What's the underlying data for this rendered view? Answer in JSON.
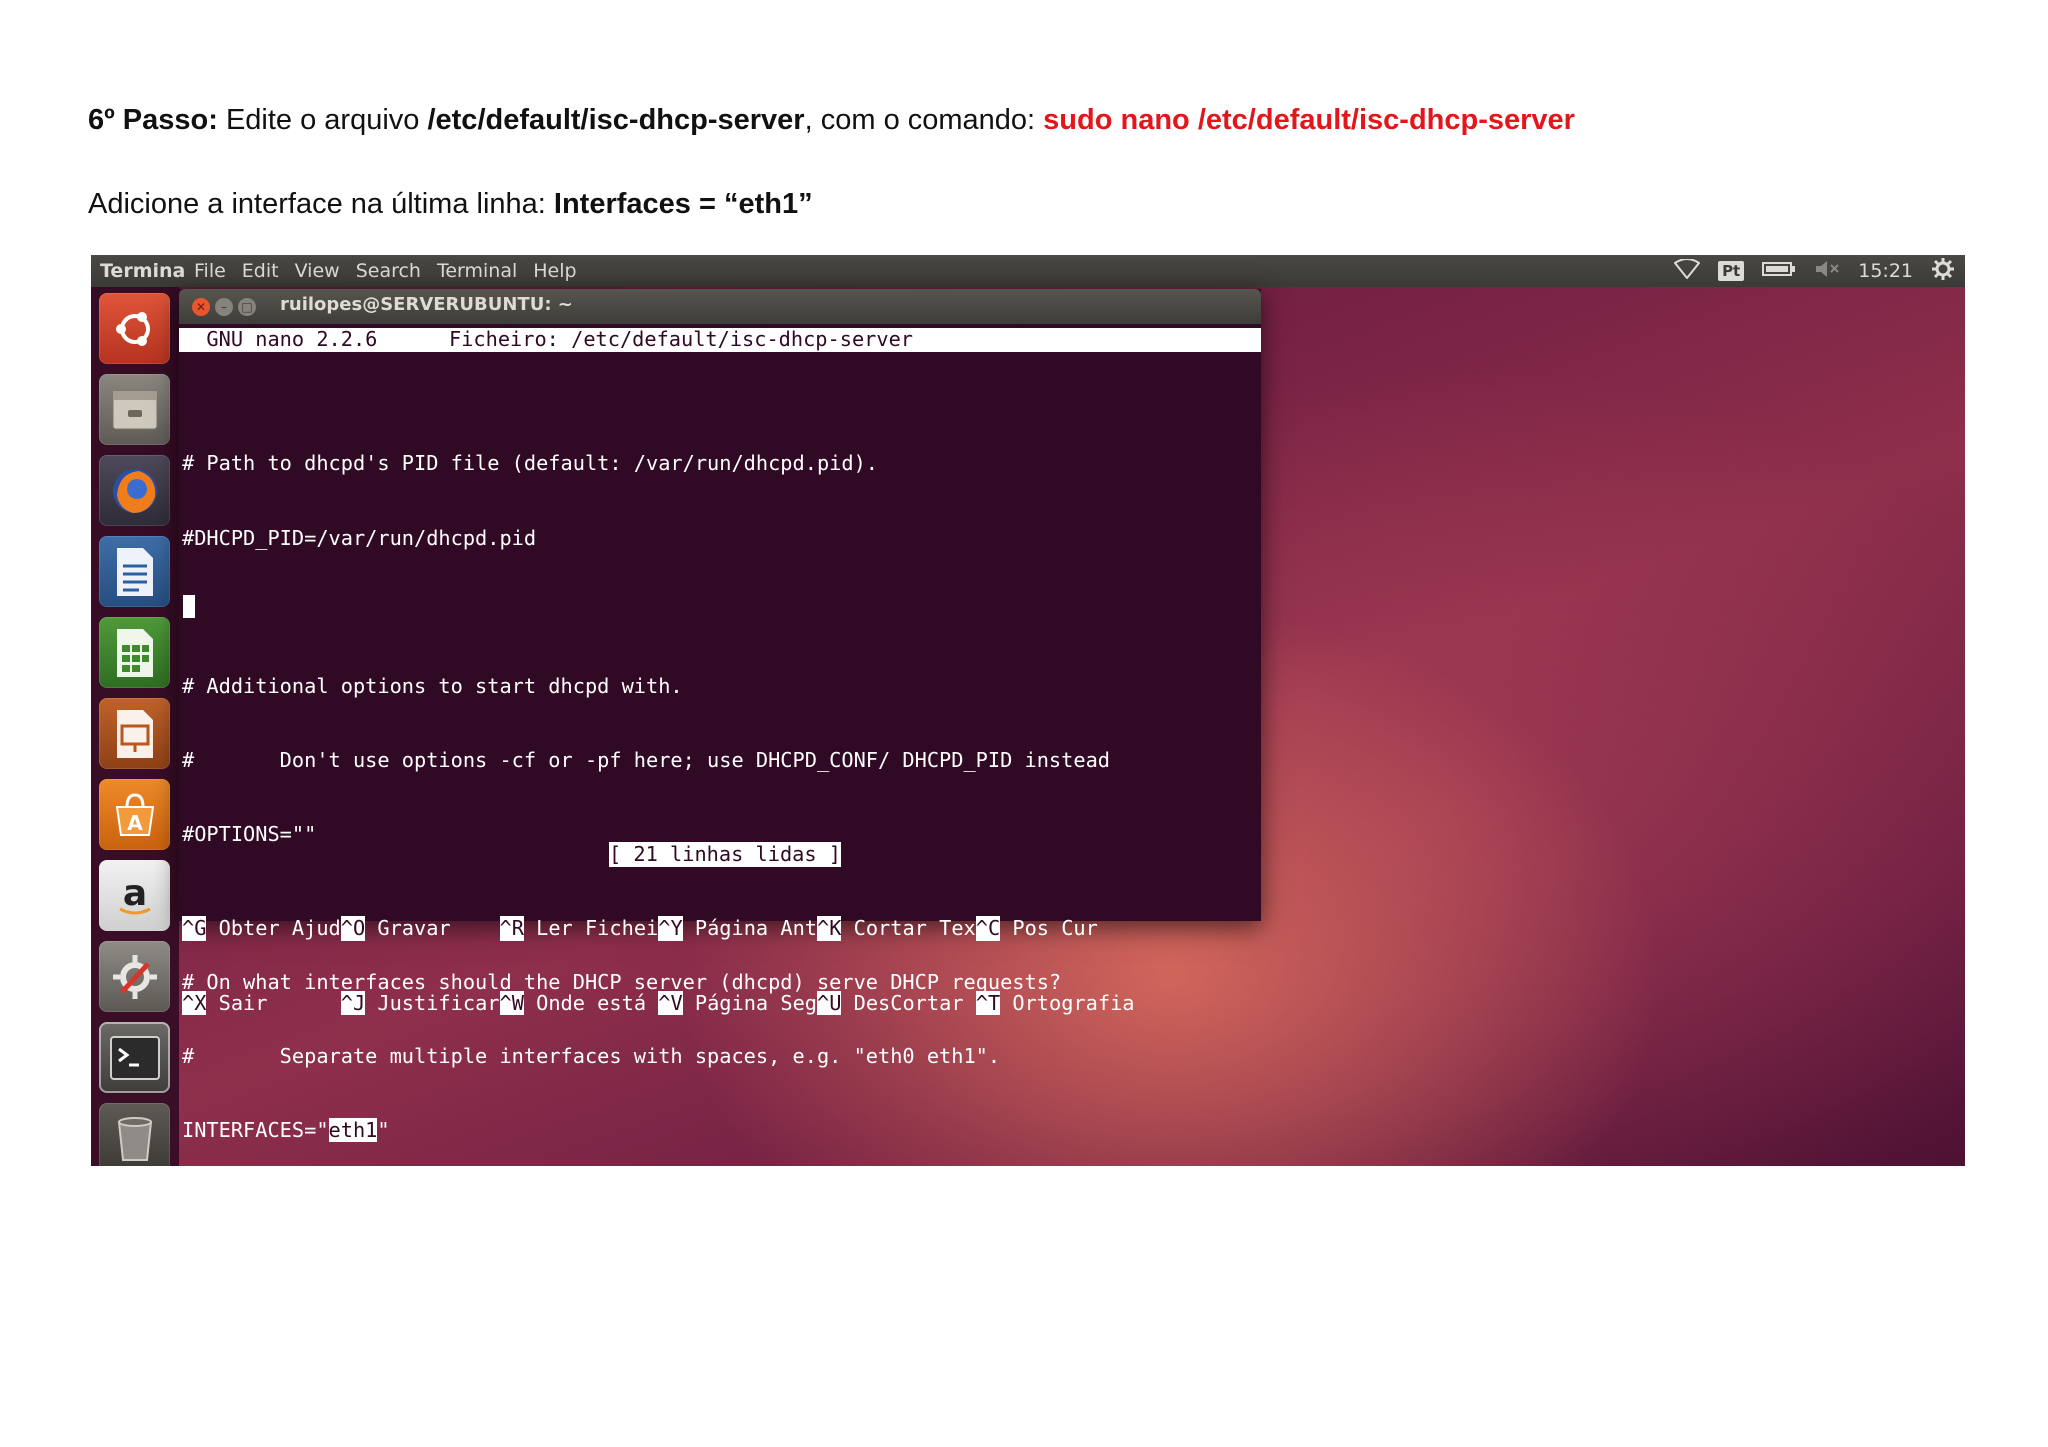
{
  "doc": {
    "step_label": "6º Passo:",
    "step_text_1": " Edite o arquivo ",
    "step_path": "/etc/default/isc-dhcp-server",
    "step_text_2": ", com o comando: ",
    "step_command": "sudo nano /etc/default/isc-dhcp-server",
    "add_text": "Adicione a interface na última linha: ",
    "add_bold": "Interfaces = “eth1”"
  },
  "topbar": {
    "app_name": "Terminal",
    "menu": [
      "File",
      "Edit",
      "View",
      "Search",
      "Terminal",
      "Help"
    ],
    "keyboard_layout": "Pt",
    "clock": "15:21",
    "icons": [
      "wifi-icon",
      "keyboard-layout-icon",
      "battery-icon",
      "volume-muted-icon",
      "settings-gear-icon"
    ]
  },
  "launcher": {
    "items": [
      "ubuntu-dash-icon",
      "files-icon",
      "firefox-icon",
      "writer-icon",
      "calc-icon",
      "impress-icon",
      "software-center-icon",
      "amazon-icon",
      "system-settings-icon",
      "terminal-icon",
      "trash-icon"
    ]
  },
  "terminal": {
    "title": "ruilopes@SERVERUBUNTU: ~",
    "nano_header_left": "  GNU nano 2.2.6",
    "nano_header_right": "Ficheiro: /etc/default/isc-dhcp-server",
    "lines": [
      "# Path to dhcpd's PID file (default: /var/run/dhcpd.pid).",
      "#DHCPD_PID=/var/run/dhcpd.pid",
      "",
      "# Additional options to start dhcpd with.",
      "#       Don't use options -cf or -pf here; use DHCPD_CONF/ DHCPD_PID instead",
      "#OPTIONS=\"\"",
      "",
      "# On what interfaces should the DHCP server (dhcpd) serve DHCP requests?",
      "#       Separate multiple interfaces with spaces, e.g. \"eth0 eth1\"."
    ],
    "interfaces_prefix": "INTERFACES=\"",
    "interfaces_value": "eth1",
    "interfaces_suffix": "\"",
    "status": "[ 21 linhas lidas ]",
    "shortcuts_row1": [
      {
        "key": "^G",
        "label": " Obter Ajud"
      },
      {
        "key": "^O",
        "label": " Gravar    "
      },
      {
        "key": "^R",
        "label": " Ler Fichei"
      },
      {
        "key": "^Y",
        "label": " Página Ant"
      },
      {
        "key": "^K",
        "label": " Cortar Tex"
      },
      {
        "key": "^C",
        "label": " Pos Cur"
      }
    ],
    "shortcuts_row2": [
      {
        "key": "^X",
        "label": " Sair      "
      },
      {
        "key": "^J",
        "label": " Justificar"
      },
      {
        "key": "^W",
        "label": " Onde está "
      },
      {
        "key": "^V",
        "label": " Página Seg"
      },
      {
        "key": "^U",
        "label": " DesCortar "
      },
      {
        "key": "^T",
        "label": " Ortografia"
      }
    ]
  }
}
